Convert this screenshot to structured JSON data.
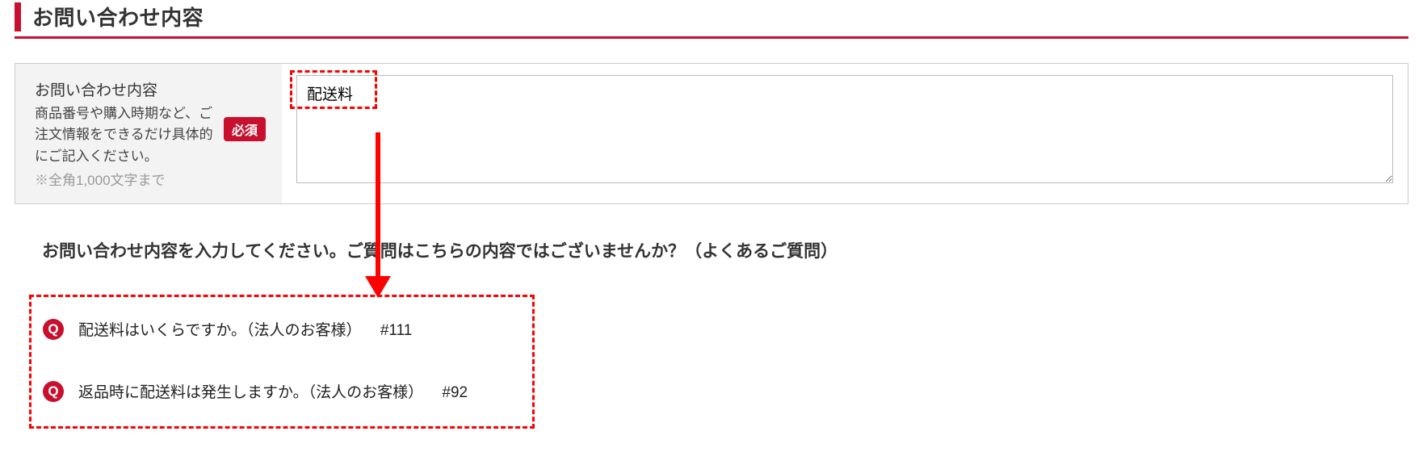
{
  "section": {
    "title": "お問い合わせ内容"
  },
  "form": {
    "label_title": "お問い合わせ内容",
    "label_desc": "商品番号や購入時期など、ご注文情報をできるだけ具体的にご記入ください。",
    "label_note": "※全角1,000文字まで",
    "required_badge": "必須",
    "textarea_value": "配送料"
  },
  "faq": {
    "prompt": "お問い合わせ内容を入力してください。ご質問はこちらの内容ではございませんか？（よくあるご質問）",
    "q_label": "Q",
    "items": [
      {
        "text": "配送料はいくらですか。（法人のお客様）",
        "tag": "#111"
      },
      {
        "text": "返品時に配送料は発生しますか。（法人のお客様）",
        "tag": "#92"
      }
    ]
  },
  "colors": {
    "accent": "#c8102e",
    "highlight": "#ff0000"
  }
}
